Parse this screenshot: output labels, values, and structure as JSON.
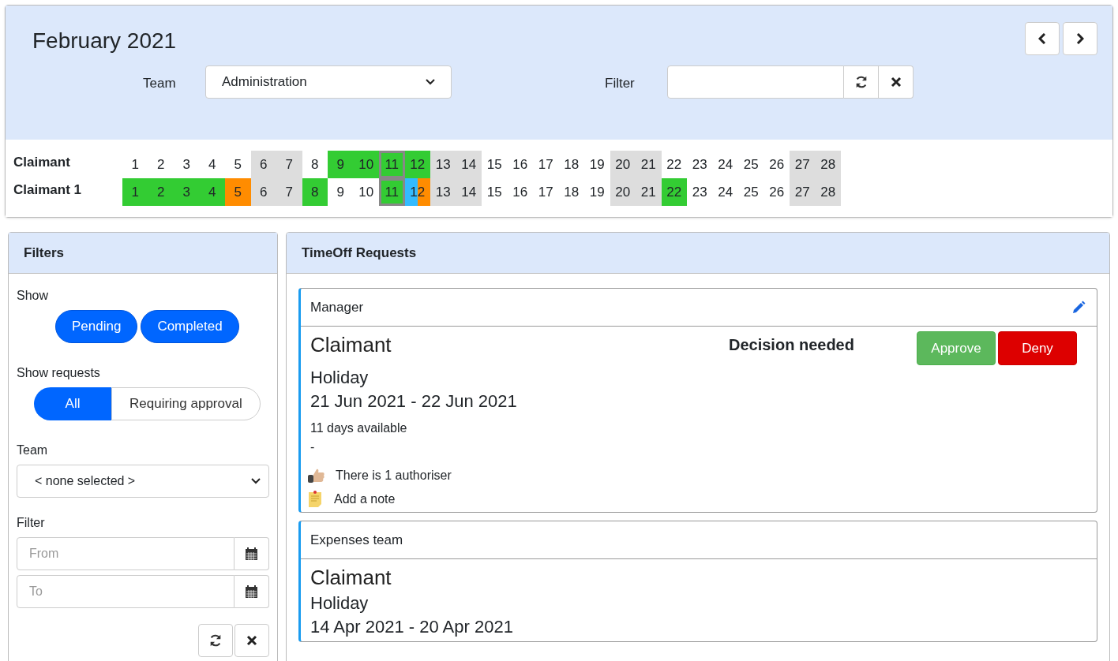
{
  "header": {
    "title": "February 2021",
    "nav": [
      {
        "kind": "prev"
      },
      {
        "kind": "next"
      }
    ],
    "team_label": "Team",
    "team_value": "Administration",
    "filter_label": "Filter"
  },
  "calendar": [
    {
      "name": "Claimant",
      "days": [
        {
          "d": "1",
          "today": false
        },
        {
          "d": "2",
          "today": false
        },
        {
          "d": "3",
          "today": false
        },
        {
          "d": "4",
          "today": false
        },
        {
          "d": "5",
          "today": false
        },
        {
          "d": "6",
          "color": "#dddddd",
          "today": false
        },
        {
          "d": "7",
          "color": "#dddddd",
          "today": false
        },
        {
          "d": "8",
          "today": false
        },
        {
          "d": "9",
          "color": "#33cc33",
          "today": false
        },
        {
          "d": "10",
          "color": "#33cc33",
          "today": false
        },
        {
          "d": "11",
          "color": "#33cc33",
          "today": true
        },
        {
          "d": "12",
          "color": "#33cc33",
          "today": false
        },
        {
          "d": "13",
          "color": "#dddddd",
          "today": false
        },
        {
          "d": "14",
          "color": "#dddddd",
          "today": false
        },
        {
          "d": "15",
          "today": false
        },
        {
          "d": "16",
          "today": false
        },
        {
          "d": "17",
          "today": false
        },
        {
          "d": "18",
          "today": false
        },
        {
          "d": "19",
          "today": false
        },
        {
          "d": "20",
          "color": "#dddddd",
          "today": false
        },
        {
          "d": "21",
          "color": "#dddddd",
          "today": false
        },
        {
          "d": "22",
          "today": false
        },
        {
          "d": "23",
          "today": false
        },
        {
          "d": "24",
          "today": false
        },
        {
          "d": "25",
          "today": false
        },
        {
          "d": "26",
          "today": false
        },
        {
          "d": "27",
          "color": "#dddddd",
          "today": false
        },
        {
          "d": "28",
          "color": "#dddddd",
          "today": false
        }
      ]
    },
    {
      "name": "Claimant 1",
      "days": [
        {
          "d": "1",
          "color": "#33cc33",
          "today": false
        },
        {
          "d": "2",
          "color": "#33cc33",
          "today": false
        },
        {
          "d": "3",
          "color": "#33cc33",
          "today": false
        },
        {
          "d": "4",
          "color": "#33cc33",
          "today": false
        },
        {
          "d": "5",
          "color": "#ff8c00",
          "today": false
        },
        {
          "d": "6",
          "color": "#dddddd",
          "today": false
        },
        {
          "d": "7",
          "color": "#dddddd",
          "today": false
        },
        {
          "d": "8",
          "color": "#33cc33",
          "today": false
        },
        {
          "d": "9",
          "today": false
        },
        {
          "d": "10",
          "today": false
        },
        {
          "d": "11",
          "color": "#33cc33",
          "today": true
        },
        {
          "d": "12",
          "segments": [
            {
              "color": "#33bbff"
            },
            {
              "color": "#ff8c00"
            }
          ],
          "today": false
        },
        {
          "d": "13",
          "color": "#dddddd",
          "today": false
        },
        {
          "d": "14",
          "color": "#dddddd",
          "today": false
        },
        {
          "d": "15",
          "today": false
        },
        {
          "d": "16",
          "today": false
        },
        {
          "d": "17",
          "today": false
        },
        {
          "d": "18",
          "today": false
        },
        {
          "d": "19",
          "today": false
        },
        {
          "d": "20",
          "color": "#dddddd",
          "today": false
        },
        {
          "d": "21",
          "color": "#dddddd",
          "today": false
        },
        {
          "d": "22",
          "color": "#33cc33",
          "today": false
        },
        {
          "d": "23",
          "today": false
        },
        {
          "d": "24",
          "today": false
        },
        {
          "d": "25",
          "today": false
        },
        {
          "d": "26",
          "today": false
        },
        {
          "d": "27",
          "color": "#dddddd",
          "today": false
        },
        {
          "d": "28",
          "color": "#dddddd",
          "today": false
        }
      ]
    }
  ],
  "filters": {
    "title": "Filters",
    "show_label": "Show",
    "show_options": [
      {
        "label": "Pending",
        "selected": true
      },
      {
        "label": "Completed",
        "selected": true
      }
    ],
    "requests_label": "Show requests",
    "requests_options": [
      {
        "label": "All",
        "selected": true
      },
      {
        "label": "Requiring approval",
        "selected": false
      }
    ],
    "team_label": "Team",
    "team_value": "< none selected >",
    "filter_label": "Filter",
    "from_placeholder": "From",
    "to_placeholder": "To"
  },
  "requests": {
    "title": "TimeOff Requests",
    "items": [
      {
        "group": "Manager",
        "editable": true,
        "claimant": "Claimant",
        "type": "Holiday",
        "dates": "21 Jun 2021 - 22 Jun 2021",
        "status": "Decision needed",
        "actions": [
          {
            "kind": "approve",
            "label": "Approve"
          },
          {
            "kind": "deny",
            "label": "Deny"
          }
        ],
        "available": "11 days available",
        "comment": "-",
        "authorisers": "There is 1 authoriser",
        "note": "Add a note"
      },
      {
        "group": "Expenses team",
        "editable": false,
        "claimant": "Claimant",
        "type": "Holiday",
        "dates": "14 Apr 2021 - 20 Apr 2021"
      }
    ]
  }
}
